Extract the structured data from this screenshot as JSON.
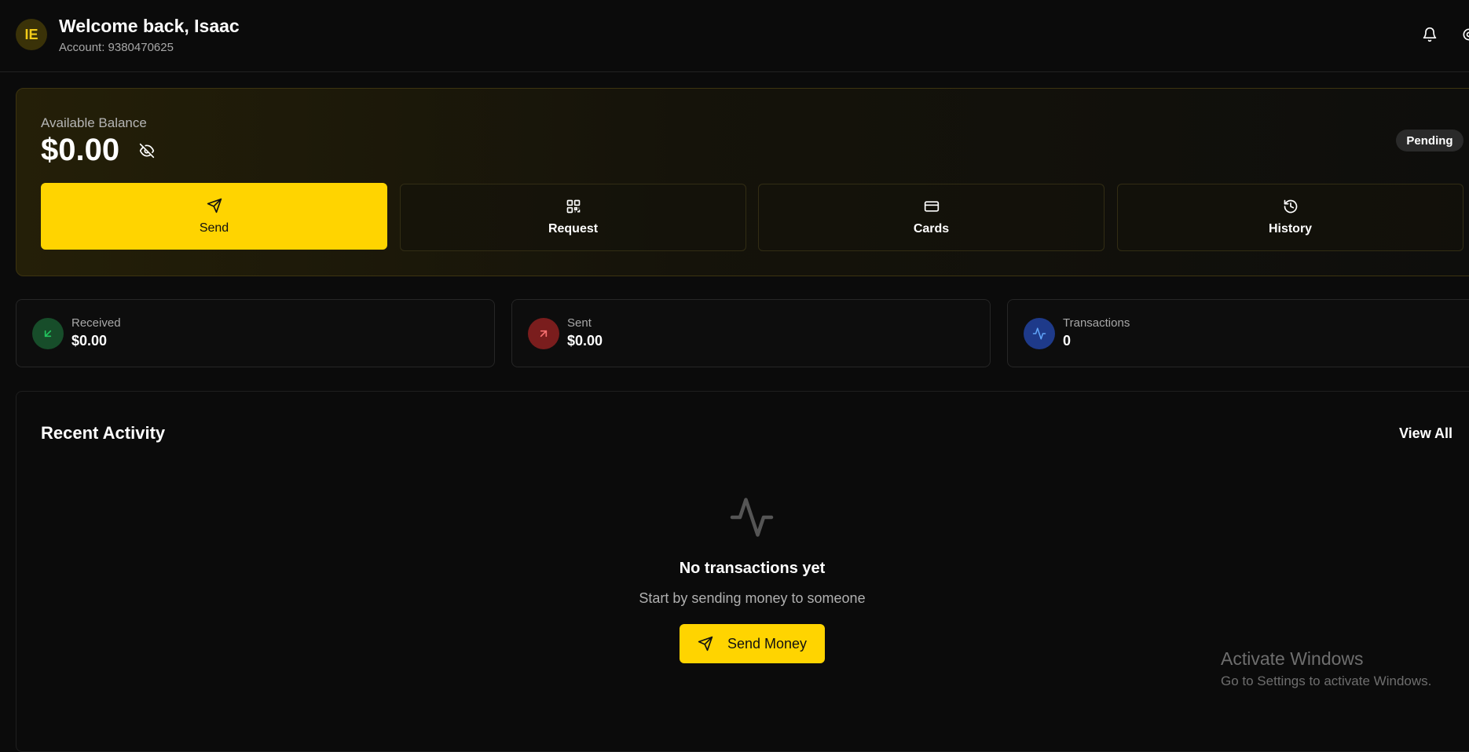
{
  "header": {
    "avatar_initials": "IE",
    "welcome": "Welcome back, Isaac",
    "account": "Account: 9380470625",
    "icons": [
      "bell-icon",
      "settings-icon"
    ]
  },
  "balance": {
    "label": "Available Balance",
    "amount": "$0.00",
    "status": "Pending",
    "actions": [
      {
        "label": "Send",
        "icon": "send-icon"
      },
      {
        "label": "Request",
        "icon": "qr-code-icon"
      },
      {
        "label": "Cards",
        "icon": "card-icon"
      },
      {
        "label": "History",
        "icon": "history-icon"
      }
    ]
  },
  "stats": [
    {
      "label": "Received",
      "value": "$0.00",
      "icon": "arrow-down-left-icon",
      "color": "#22c55e"
    },
    {
      "label": "Sent",
      "value": "$0.00",
      "icon": "arrow-up-right-icon",
      "color": "#ef4444"
    },
    {
      "label": "Transactions",
      "value": "0",
      "icon": "activity-icon",
      "color": "#3b82f6"
    }
  ],
  "activity": {
    "title": "Recent Activity",
    "view_all": "View All",
    "empty_title": "No transactions yet",
    "empty_sub": "Start by sending money to someone",
    "cta": "Send Money"
  },
  "watermark": {
    "line1": "Activate Windows",
    "line2": "Go to Settings to activate Windows."
  },
  "colors": {
    "accent": "#ffd400",
    "background": "#0b0b0b"
  }
}
